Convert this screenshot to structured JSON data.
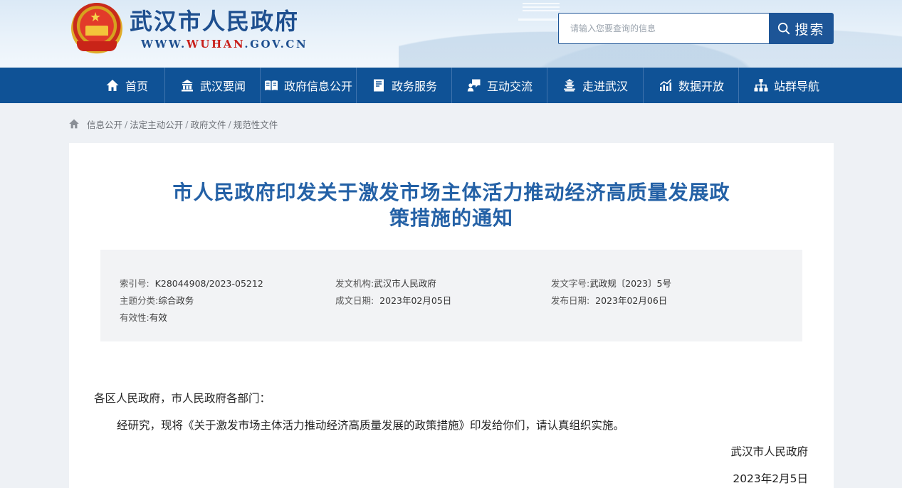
{
  "header": {
    "site_title": "武汉市人民政府",
    "site_url_prefix": "WWW.",
    "site_url_highlight": "WUHAN",
    "site_url_suffix": ".GOV.CN",
    "search": {
      "placeholder": "请输入您要查询的信息",
      "button_label": "搜索"
    }
  },
  "nav": {
    "items": [
      {
        "label": "首页",
        "icon": "home-icon"
      },
      {
        "label": "武汉要闻",
        "icon": "building-icon"
      },
      {
        "label": "政府信息公开",
        "icon": "book-icon"
      },
      {
        "label": "政务服务",
        "icon": "document-icon"
      },
      {
        "label": "互动交流",
        "icon": "chat-icon"
      },
      {
        "label": "走进武汉",
        "icon": "pagoda-icon"
      },
      {
        "label": "数据开放",
        "icon": "chart-icon"
      },
      {
        "label": "站群导航",
        "icon": "sitemap-icon"
      }
    ]
  },
  "breadcrumb": {
    "items": [
      "信息公开",
      "法定主动公开",
      "政府文件",
      "规范性文件"
    ],
    "separator": "/"
  },
  "article": {
    "title_line1": "市人民政府印发关于激发市场主体活力推动经济高质量发展政",
    "title_line2": "策措施的通知",
    "meta": {
      "index_label": "索引号:",
      "index_value": "K28044908/2023-05212",
      "issuer_label": "发文机构:",
      "issuer_value": "武汉市人民政府",
      "doc_no_label": "发文字号:",
      "doc_no_value": "武政规〔2023〕5号",
      "topic_label": "主题分类:",
      "topic_value": "综合政务",
      "created_label": "成文日期:",
      "created_value": "2023年02月05日",
      "published_label": "发布日期:",
      "published_value": "2023年02月06日",
      "validity_label": "有效性:",
      "validity_value": "有效"
    },
    "salutation": "各区人民政府，市人民政府各部门：",
    "paragraph1": "经研究，现将《关于激发市场主体活力推动经济高质量发展的政策措施》印发给你们，请认真组织实施。",
    "signature": "武汉市人民政府",
    "date": "2023年2月5日"
  },
  "colors": {
    "brand_blue": "#0f5296",
    "title_blue": "#2461a6",
    "url_red": "#c8201b"
  }
}
